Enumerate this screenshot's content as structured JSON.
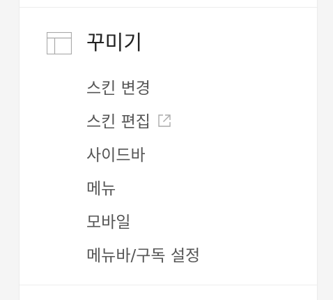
{
  "section": {
    "icon": "layout-icon",
    "title": "꾸미기"
  },
  "menu": {
    "items": [
      {
        "label": "스킨 변경"
      },
      {
        "label": "스킨 편집",
        "icon": "external-link-icon"
      },
      {
        "label": "사이드바"
      },
      {
        "label": "메뉴"
      },
      {
        "label": "모바일"
      },
      {
        "label": "메뉴바/구독 설정"
      }
    ]
  },
  "colors": {
    "title": "#222222",
    "item": "#555555",
    "icon": "#999999",
    "divider": "#ececec"
  }
}
